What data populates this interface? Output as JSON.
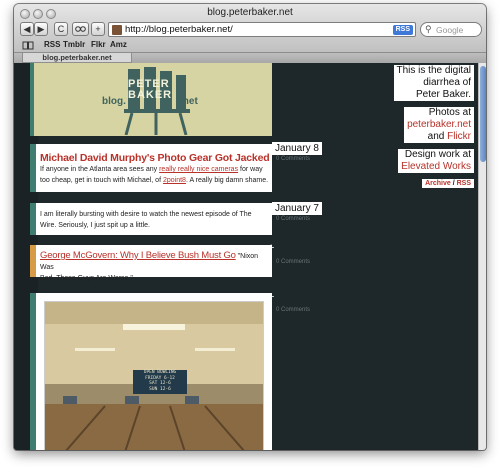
{
  "window": {
    "title": "blog.peterbaker.net"
  },
  "toolbar": {
    "back": "◀",
    "forward": "▶",
    "reload": "C",
    "add": "+",
    "url": "http://blog.peterbaker.net/",
    "rss": "RSS",
    "search_placeholder": "Google"
  },
  "bookmarks": [
    "RSS",
    "Tmblr",
    "Flkr",
    "Amz"
  ],
  "tab": {
    "label": "blog.peterbaker.net"
  },
  "header": {
    "brand_line1": "PETER",
    "brand_line2": "BAKER",
    "brand_left": "blog.",
    "brand_right": ".net"
  },
  "posts": [
    {
      "title": "Michael David Murphy's Photo Gear Got Jacked",
      "text_a": "If anyone in the Atlanta area sees any ",
      "link1": "really really nice cameras",
      "text_b": " for way too cheap, get in touch with Michael, of ",
      "link2": "2point8",
      "text_c": ". A really big damn shame.",
      "date": "January 8",
      "comments": "0 Comments"
    },
    {
      "text": "I am literally bursting with desire to watch the newest episode of The Wire. Seriously, I just spit up a little.",
      "date": "January 7",
      "comments": "0 Comments"
    },
    {
      "title": "George McGovern: Why I Believe Bush Must Go",
      "quote_a": " \"Nixon Was",
      "quote_b": "Bad. These Guys Are Worse.\"",
      "comments": "0 Comments"
    },
    {
      "sign_line1": "OPEN BOWLING",
      "sign_line2": "FRIDAY 6-12",
      "sign_line3": "SAT 12-6",
      "sign_line4": "SUN 12-6",
      "comments": "0 Comments"
    }
  ],
  "sidebar": {
    "intro": [
      "This is the digital",
      "diarrhea of",
      "Peter Baker."
    ],
    "photos_prefix": "Photos at",
    "photos_site": "peterbaker.net",
    "photos_and": "and ",
    "photos_flickr": "Flickr",
    "design_prefix": "Design work at",
    "design_link": "Elevated Works",
    "archive": "Archive",
    "sep": " / ",
    "rss": "RSS"
  },
  "colors": {
    "accent": "#b8322a",
    "background": "#1e272a",
    "stripe_green": "#3f7d70",
    "stripe_orange": "#d79a45"
  }
}
